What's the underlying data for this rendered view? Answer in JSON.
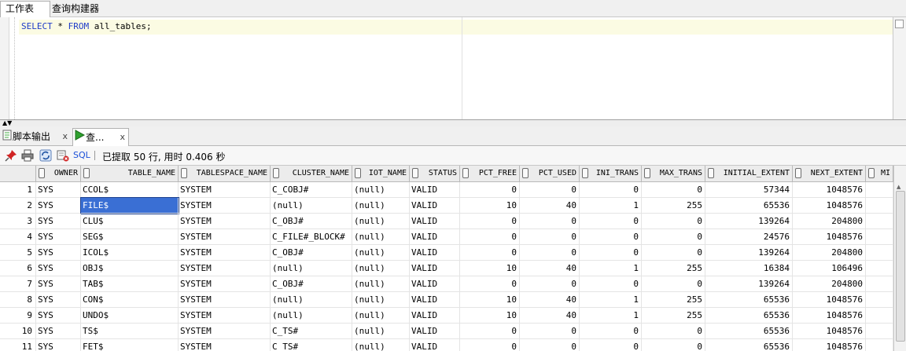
{
  "top_tabs": [
    {
      "label": "工作表",
      "active": true
    },
    {
      "label": "查询构建器",
      "active": false
    }
  ],
  "editor": {
    "sql": [
      {
        "text": "SELECT",
        "kind": "keyword"
      },
      {
        "text": " * ",
        "kind": "plain"
      },
      {
        "text": "FROM",
        "kind": "keyword"
      },
      {
        "text": " all_tables;",
        "kind": "plain"
      }
    ]
  },
  "output_tabs": [
    {
      "label": "脚本输出",
      "close": "x"
    },
    {
      "label": "查...",
      "close": "x"
    }
  ],
  "toolbar": {
    "sql_label": "SQL",
    "separator": "|",
    "status": "已提取 50 行, 用时 0.406 秒"
  },
  "grid": {
    "columns": [
      "OWNER",
      "TABLE_NAME",
      "TABLESPACE_NAME",
      "CLUSTER_NAME",
      "IOT_NAME",
      "STATUS",
      "PCT_FREE",
      "PCT_USED",
      "INI_TRANS",
      "MAX_TRANS",
      "INITIAL_EXTENT",
      "NEXT_EXTENT",
      "MI"
    ],
    "selected_cell": {
      "row": 2,
      "column": "TABLE_NAME"
    },
    "rows": [
      {
        "n": "1",
        "cells": [
          "SYS",
          "CCOL$",
          "SYSTEM",
          "C_COBJ#",
          "(null)",
          "VALID",
          "0",
          "0",
          "0",
          "0",
          "57344",
          "1048576",
          ""
        ]
      },
      {
        "n": "2",
        "cells": [
          "SYS",
          "FILE$",
          "SYSTEM",
          "(null)",
          "(null)",
          "VALID",
          "10",
          "40",
          "1",
          "255",
          "65536",
          "1048576",
          ""
        ]
      },
      {
        "n": "3",
        "cells": [
          "SYS",
          "CLU$",
          "SYSTEM",
          "C_OBJ#",
          "(null)",
          "VALID",
          "0",
          "0",
          "0",
          "0",
          "139264",
          "204800",
          ""
        ]
      },
      {
        "n": "4",
        "cells": [
          "SYS",
          "SEG$",
          "SYSTEM",
          "C_FILE#_BLOCK#",
          "(null)",
          "VALID",
          "0",
          "0",
          "0",
          "0",
          "24576",
          "1048576",
          ""
        ]
      },
      {
        "n": "5",
        "cells": [
          "SYS",
          "ICOL$",
          "SYSTEM",
          "C_OBJ#",
          "(null)",
          "VALID",
          "0",
          "0",
          "0",
          "0",
          "139264",
          "204800",
          ""
        ]
      },
      {
        "n": "6",
        "cells": [
          "SYS",
          "OBJ$",
          "SYSTEM",
          "(null)",
          "(null)",
          "VALID",
          "10",
          "40",
          "1",
          "255",
          "16384",
          "106496",
          ""
        ]
      },
      {
        "n": "7",
        "cells": [
          "SYS",
          "TAB$",
          "SYSTEM",
          "C_OBJ#",
          "(null)",
          "VALID",
          "0",
          "0",
          "0",
          "0",
          "139264",
          "204800",
          ""
        ]
      },
      {
        "n": "8",
        "cells": [
          "SYS",
          "CON$",
          "SYSTEM",
          "(null)",
          "(null)",
          "VALID",
          "10",
          "40",
          "1",
          "255",
          "65536",
          "1048576",
          ""
        ]
      },
      {
        "n": "9",
        "cells": [
          "SYS",
          "UNDO$",
          "SYSTEM",
          "(null)",
          "(null)",
          "VALID",
          "10",
          "40",
          "1",
          "255",
          "65536",
          "1048576",
          ""
        ]
      },
      {
        "n": "10",
        "cells": [
          "SYS",
          "TS$",
          "SYSTEM",
          "C_TS#",
          "(null)",
          "VALID",
          "0",
          "0",
          "0",
          "0",
          "65536",
          "1048576",
          ""
        ]
      },
      {
        "n": "11",
        "cells": [
          "SYS",
          "FET$",
          "SYSTEM",
          "C_TS#",
          "(null)",
          "VALID",
          "0",
          "0",
          "0",
          "0",
          "65536",
          "1048576",
          ""
        ]
      }
    ]
  },
  "icons": {
    "pin": "pin-icon",
    "print": "print-icon",
    "refresh": "refresh-icon",
    "clear": "clear-icon",
    "run": "run-icon",
    "script": "script-icon"
  },
  "colors": {
    "keyword": "#1f3cc8",
    "selection": "#3a6fd4",
    "current_line": "#fbfbe3"
  }
}
